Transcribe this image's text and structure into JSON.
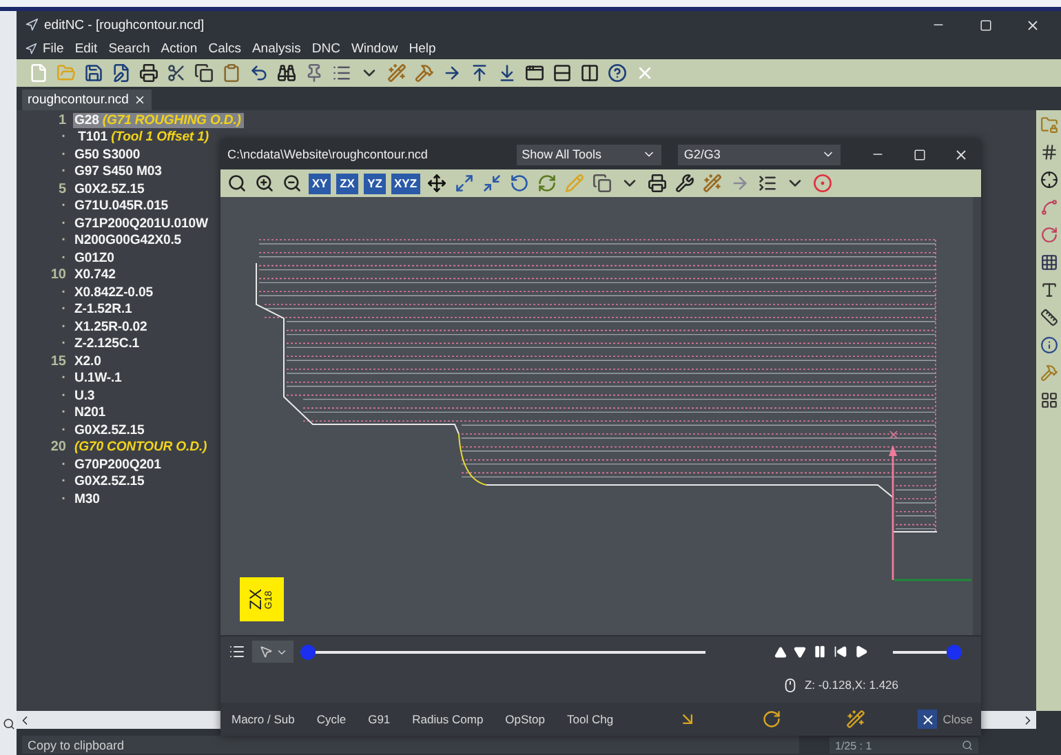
{
  "window": {
    "title": "editNC - [roughcontour.ncd]"
  },
  "menu": [
    "File",
    "Edit",
    "Search",
    "Action",
    "Calcs",
    "Analysis",
    "DNC",
    "Window",
    "Help"
  ],
  "tabs": [
    {
      "label": "roughcontour.ncd",
      "selected": true
    }
  ],
  "editor": {
    "lines": [
      {
        "number": "1",
        "code": "G28",
        "comment": "(G71 ROUGHING O.D.)",
        "selected": true
      },
      {
        "number": "·",
        "code": " T101",
        "comment": "(Tool 1 Offset 1)",
        "selected": false
      },
      {
        "number": "·",
        "code": "G50 S3000",
        "selected": false
      },
      {
        "number": "·",
        "code": "G97 S450 M03",
        "selected": false
      },
      {
        "number": "5",
        "code": "G0X2.5Z.15",
        "selected": false
      },
      {
        "number": "·",
        "code": "G71U.045R.015",
        "selected": false
      },
      {
        "number": "·",
        "code": "G71P200Q201U.010W",
        "selected": false
      },
      {
        "number": "·",
        "code": "N200G00G42X0.5",
        "selected": false
      },
      {
        "number": "·",
        "code": "G01Z0",
        "selected": false
      },
      {
        "number": "10",
        "code": "X0.742",
        "selected": false
      },
      {
        "number": "·",
        "code": "X0.842Z-0.05",
        "selected": false
      },
      {
        "number": "·",
        "code": "Z-1.52R.1",
        "selected": false
      },
      {
        "number": "·",
        "code": "X1.25R-0.02",
        "selected": false
      },
      {
        "number": "·",
        "code": "Z-2.125C.1",
        "selected": false
      },
      {
        "number": "15",
        "code": "X2.0",
        "selected": false
      },
      {
        "number": "·",
        "code": "U.1W-.1",
        "selected": false
      },
      {
        "number": "·",
        "code": "U.3",
        "selected": false
      },
      {
        "number": "·",
        "code": "N201",
        "selected": false
      },
      {
        "number": "·",
        "code": "G0X2.5Z.15",
        "selected": false
      },
      {
        "number": "20",
        "comment": "(G70 CONTOUR O.D.)",
        "selected": false
      },
      {
        "number": "·",
        "code": "G70P200Q201",
        "selected": false
      },
      {
        "number": "·",
        "code": "G0X2.5Z.15",
        "selected": false
      },
      {
        "number": "·",
        "code": "M30",
        "selected": false
      }
    ]
  },
  "status_bar": {
    "message": "Copy to clipboard",
    "search": "1/25 : 1"
  },
  "backplot": {
    "path": "C:\\ncdata\\Website\\roughcontour.ncd",
    "tool_filter": "Show All Tools",
    "arc_mode": "G2/G3",
    "view_buttons": [
      "XY",
      "ZX",
      "YZ",
      "XYZ"
    ],
    "plane_badge": {
      "plane": "ZX",
      "code": "G18"
    },
    "player": {
      "position": {
        "level": 0
      },
      "speed": {
        "level": 1
      }
    },
    "cursor_readout": "Z: -0.128,X: 1.426",
    "options": [
      "Macro / Sub",
      "Cycle",
      "G91",
      "Radius Comp",
      "OpStop",
      "Tool Chg"
    ],
    "close": "Close"
  }
}
